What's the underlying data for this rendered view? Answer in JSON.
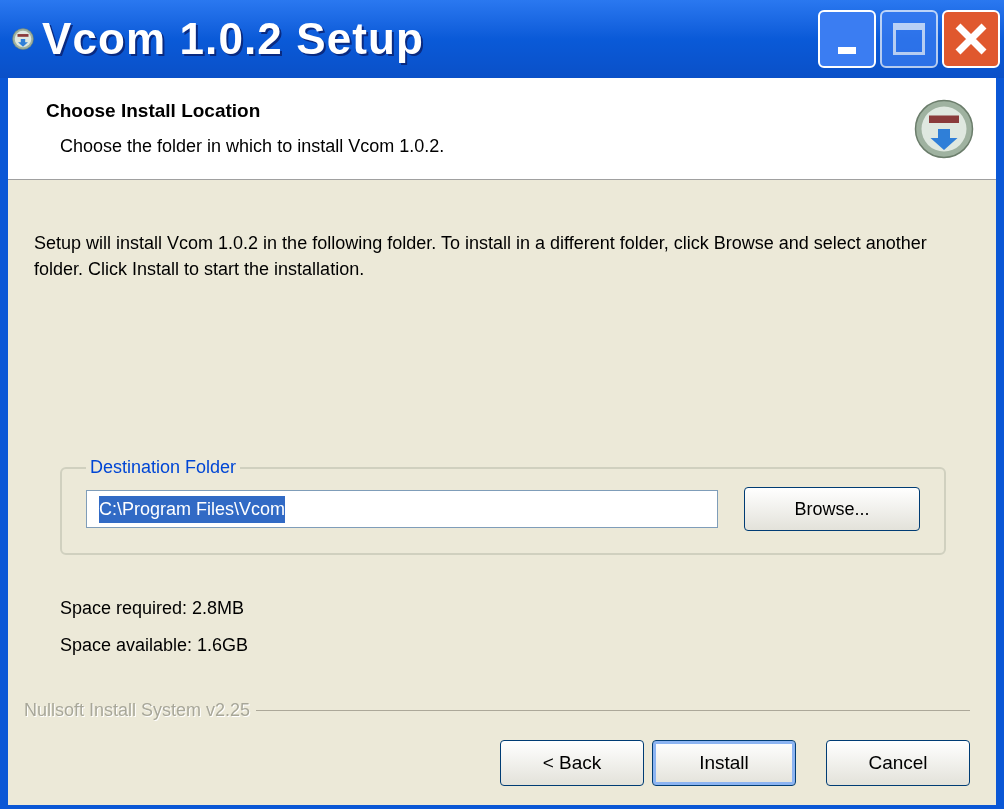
{
  "window": {
    "title": "Vcom 1.0.2 Setup"
  },
  "header": {
    "title": "Choose Install Location",
    "subtitle": "Choose the folder in which to install Vcom 1.0.2."
  },
  "intro": "Setup will install Vcom 1.0.2 in the following folder. To install in a different folder, click Browse and select another folder. Click Install to start the installation.",
  "destination": {
    "legend": "Destination Folder",
    "path": "C:\\Program Files\\Vcom",
    "selected": true,
    "browse": "Browse..."
  },
  "space": [
    "Space required: 2.8MB",
    "Space available: 1.6GB"
  ],
  "branding": "Nullsoft Install System v2.25",
  "buttons": [
    {
      "label": "< Back",
      "default": false
    },
    {
      "label": "Install",
      "default": true
    },
    {
      "label": "Cancel",
      "default": false
    }
  ]
}
